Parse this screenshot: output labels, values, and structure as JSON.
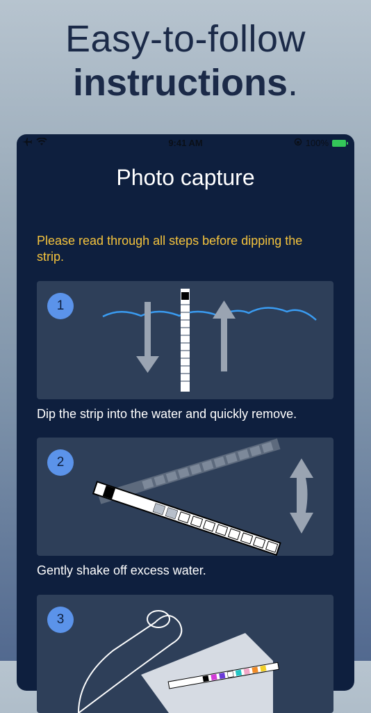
{
  "headline": {
    "line1": "Easy-to-follow",
    "line2": "instructions",
    "line2_suffix": "."
  },
  "status_bar": {
    "time": "9:41 AM",
    "battery": "100%"
  },
  "screen": {
    "title": "Photo capture",
    "notice": "Please read through all steps before dipping the strip.",
    "steps": [
      {
        "number": "1",
        "caption": "Dip the strip into the water and quickly remove."
      },
      {
        "number": "2",
        "caption": "Gently shake off excess water."
      },
      {
        "number": "3",
        "caption": ""
      }
    ]
  },
  "colors": {
    "accent": "#5b93ea",
    "notice": "#f4c33d",
    "card": "#2e3f59",
    "screen": "#0e1f3e"
  }
}
